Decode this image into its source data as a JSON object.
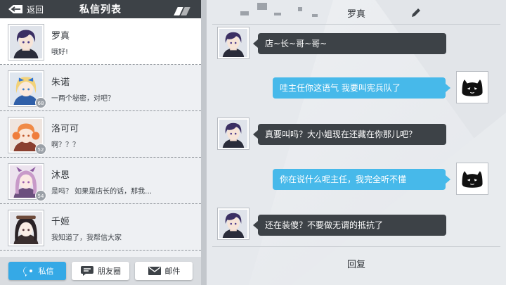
{
  "header": {
    "back_label": "返回",
    "title": "私信列表"
  },
  "contacts": [
    {
      "name": "罗真",
      "preview": "哦好!",
      "level": "",
      "active": true
    },
    {
      "name": "朱诺",
      "preview": "一两个秘密，对吧？",
      "level": "68"
    },
    {
      "name": "洛可可",
      "preview": "啊？？？",
      "level": "52"
    },
    {
      "name": "沐恩",
      "preview": "是吗？  如果是店长的话，那我…",
      "level": "54"
    },
    {
      "name": "千姬",
      "preview": "我知道了，我帮信大家",
      "level": ""
    }
  ],
  "tabs": {
    "messages": "私信",
    "moments": "朋友圈",
    "mail": "邮件"
  },
  "chat": {
    "title": "罗真",
    "reply_label": "回复",
    "messages": [
      {
        "side": "left",
        "text": "店~长~哥~哥~"
      },
      {
        "side": "right",
        "text": "哇主任你这语气 我要叫宪兵队了"
      },
      {
        "side": "left",
        "text": "真要叫吗？大小姐现在还藏在你那儿吧？"
      },
      {
        "side": "right",
        "text": "你在说什么呢主任，我完全听不懂"
      },
      {
        "side": "left",
        "text": "还在装傻？不要做无谓的抵抗了"
      }
    ]
  },
  "icons": {
    "back": "back-arrow-icon",
    "edit": "pencil-icon",
    "messages_tab": "chat-bubble-icon",
    "moments_tab": "speech-bubble-icon",
    "mail_tab": "envelope-icon",
    "player_avatar": "black-cat-icon"
  },
  "colors": {
    "dark": "#3d4247",
    "accent": "#35a9e6",
    "bubble_right": "#47b9ea"
  }
}
